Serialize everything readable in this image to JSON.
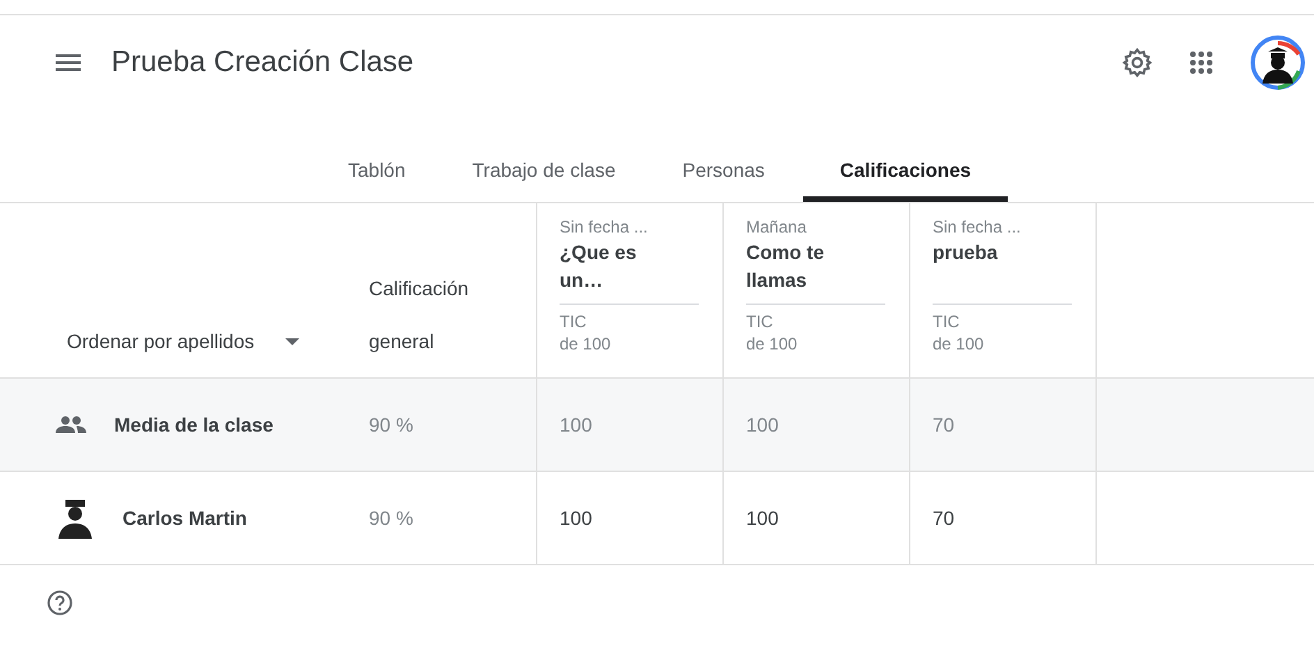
{
  "header": {
    "title": "Prueba Creación Clase"
  },
  "tabs": [
    {
      "label": "Tablón",
      "selected": false
    },
    {
      "label": "Trabajo de clase",
      "selected": false
    },
    {
      "label": "Personas",
      "selected": false
    },
    {
      "label": "Calificaciones",
      "selected": true
    }
  ],
  "table": {
    "sort_label": "Ordenar por apellidos",
    "overall_heading": [
      "Calificación",
      "general"
    ],
    "assignments": [
      {
        "due": "Sin fecha ...",
        "title": "¿Que es un…",
        "category": "TIC",
        "points": "de 100"
      },
      {
        "due": "Mañana",
        "title": "Como te llamas",
        "category": "TIC",
        "points": "de 100"
      },
      {
        "due": "Sin fecha ...",
        "title": "prueba",
        "category": "TIC",
        "points": "de 100"
      }
    ],
    "rows": [
      {
        "kind": "average",
        "name": "Media de la clase",
        "overall": "90 %",
        "grades": [
          "100",
          "100",
          "70"
        ]
      },
      {
        "kind": "student",
        "name": "Carlos Martin",
        "overall": "90 %",
        "grades": [
          "100",
          "100",
          "70"
        ]
      }
    ]
  }
}
